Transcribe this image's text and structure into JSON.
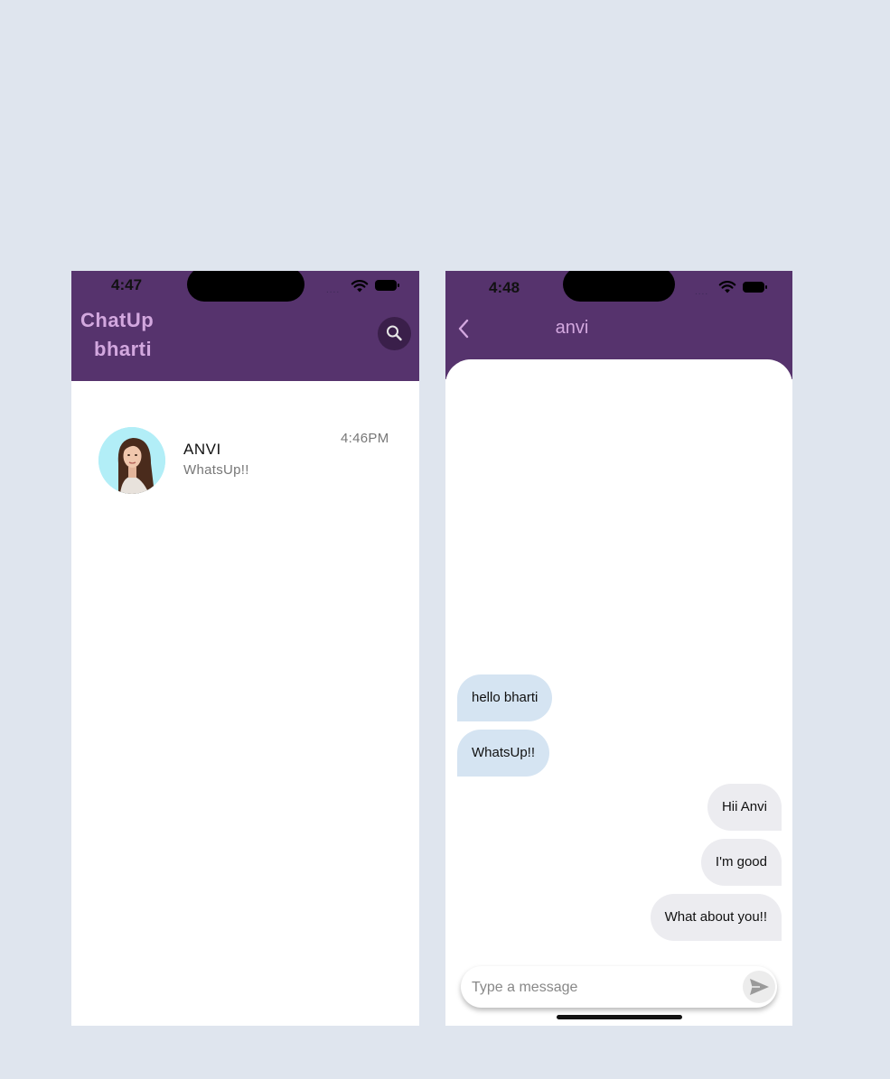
{
  "chat_list_screen": {
    "status_time": "4:47",
    "signal_dots": "....",
    "app_title_line1": "ChatUp",
    "app_title_line2": "bharti",
    "icons": {
      "search": "search-icon",
      "wifi": "wifi-icon",
      "battery": "battery-icon"
    },
    "chats": [
      {
        "name": "ANVI",
        "last_message": "WhatsUp!!",
        "time": "4:46PM",
        "avatar": "avatar-photo"
      }
    ]
  },
  "conversation_screen": {
    "status_time": "4:48",
    "signal_dots": "....",
    "contact_name": "anvi",
    "icons": {
      "back": "chevron-left-icon",
      "send": "send-icon"
    },
    "messages": [
      {
        "text": "hello bharti",
        "direction": "incoming"
      },
      {
        "text": "WhatsUp!!",
        "direction": "incoming"
      },
      {
        "text": "Hii Anvi",
        "direction": "outgoing"
      },
      {
        "text": "I'm good",
        "direction": "outgoing"
      },
      {
        "text": "What about you!!",
        "direction": "outgoing"
      }
    ],
    "composer": {
      "placeholder": "Type a message",
      "value": ""
    }
  },
  "colors": {
    "header": "#56336d",
    "title": "#d3a8df",
    "incoming_bubble": "#d5e4f2",
    "outgoing_bubble": "#ececf0",
    "background": "#dfe5ee"
  }
}
